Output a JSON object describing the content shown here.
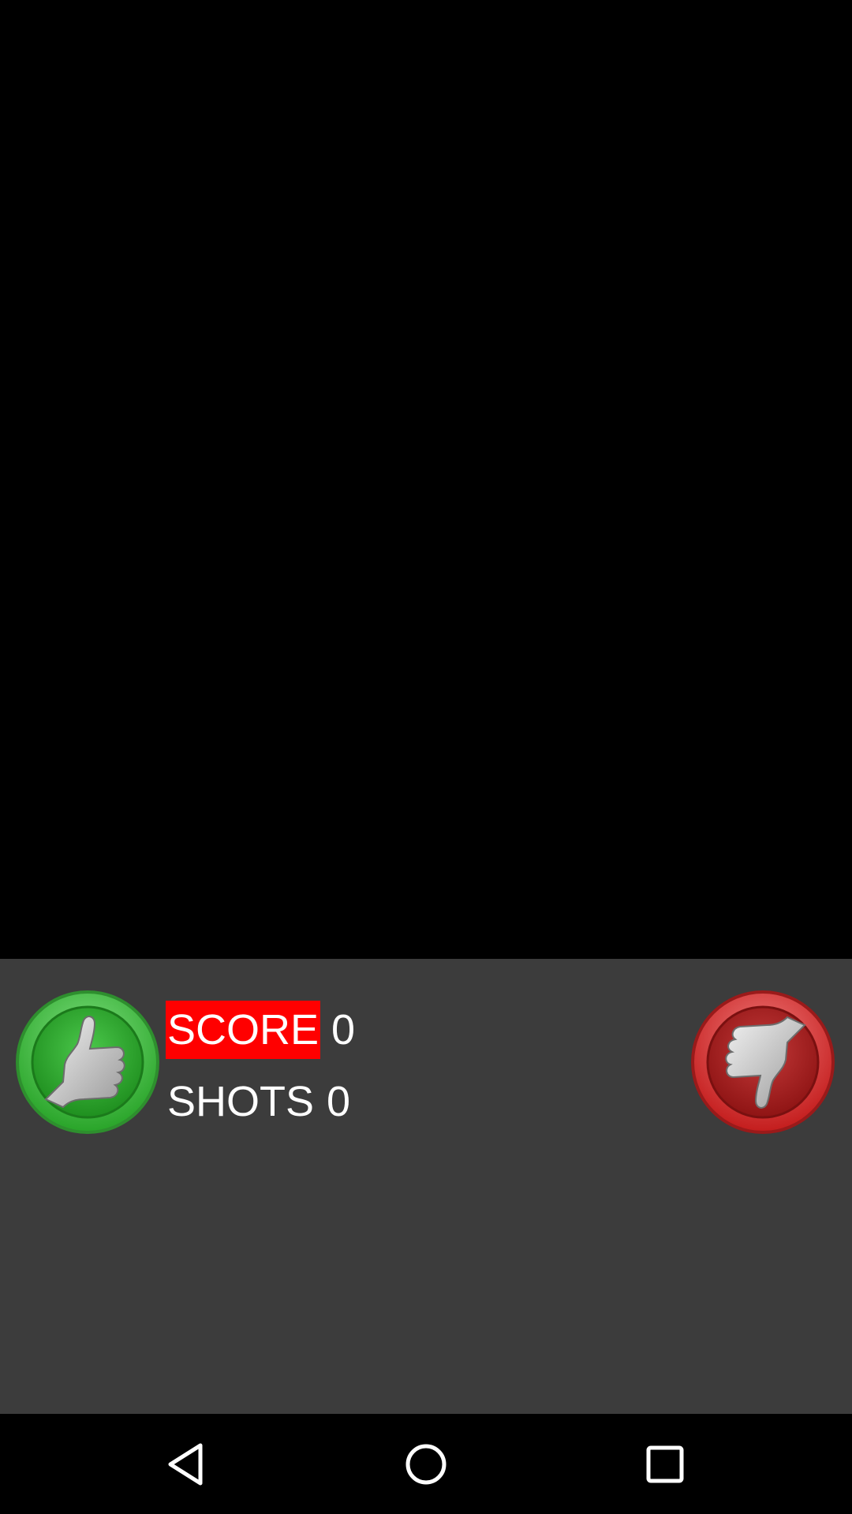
{
  "scoreboard": {
    "score_label": "SCORE",
    "score_value": "0",
    "shots_label": "SHOTS",
    "shots_value": "0"
  },
  "buttons": {
    "left": {
      "icon": "thumbs-up-icon",
      "color": "#3cbf3c"
    },
    "right": {
      "icon": "thumbs-down-icon",
      "color": "#d42a2a"
    }
  },
  "colors": {
    "panel_background": "#3c3c3c",
    "score_highlight": "#ff0000",
    "text": "#ffffff"
  },
  "navigation": {
    "back_icon": "back-triangle-icon",
    "home_icon": "home-circle-icon",
    "recent_icon": "recents-square-icon"
  }
}
